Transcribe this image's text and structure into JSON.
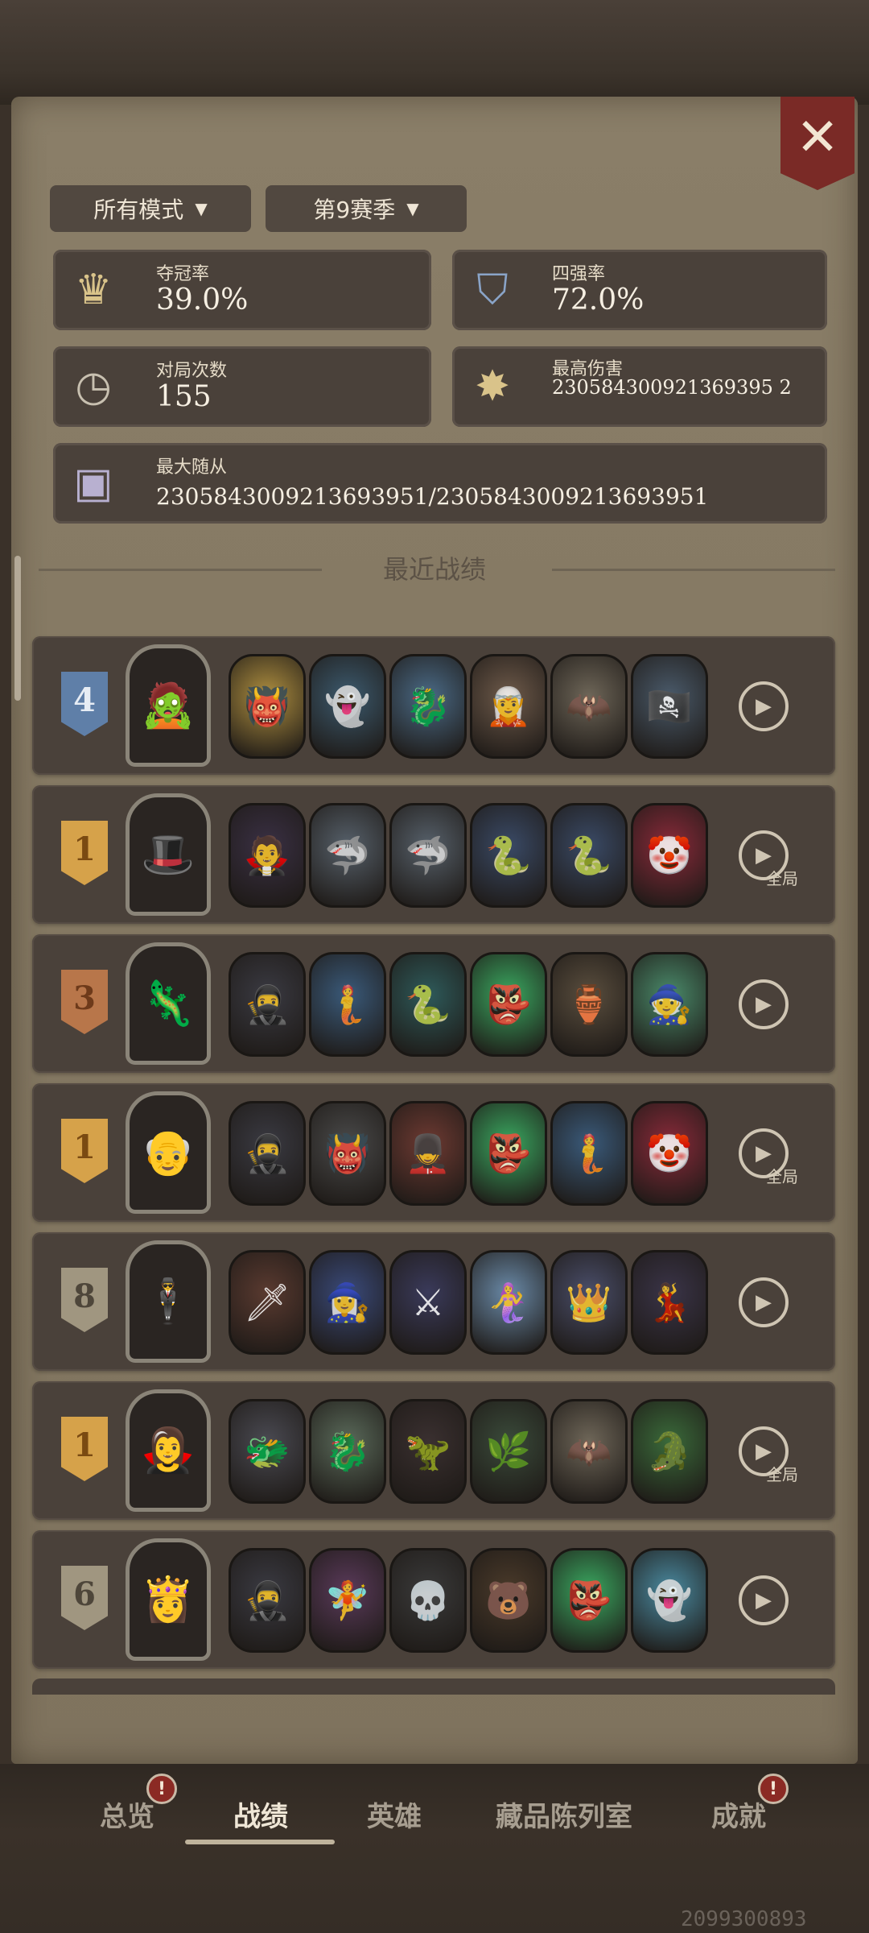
{
  "filters": {
    "mode_label": "所有模式",
    "season_label": "第9赛季",
    "dropdown_icon": "triangle-down-icon"
  },
  "stats": {
    "win_rate": {
      "label": "夺冠率",
      "value": "39.0%",
      "icon": "crown-icon"
    },
    "top4_rate": {
      "label": "四强率",
      "value": "72.0%",
      "icon": "shield-four-icon"
    },
    "games_played": {
      "label": "对局次数",
      "value": "155",
      "icon": "clock-icon"
    },
    "max_damage": {
      "label": "最高伤害",
      "value": "230584300921369395 2",
      "icon": "burst-icon"
    },
    "max_minion": {
      "label": "最大随从",
      "value": "2305843009213693951/2305843009213693951",
      "icon": "minion-portrait-icon"
    }
  },
  "section": {
    "title": "最近战绩"
  },
  "matches": [
    {
      "rank": "4",
      "badge_color": "#5f7fa8",
      "text_color": "#e6ecf4",
      "hero_icon": "🧟",
      "minions": [
        [
          "👹",
          "#b09040"
        ],
        [
          "👻",
          "#3c5a6e"
        ],
        [
          "🐉",
          "#4a6a86"
        ],
        [
          "🧝",
          "#6e5a4a"
        ],
        [
          "🦇",
          "#6e6658"
        ],
        [
          "🏴‍☠️",
          "#4a5a6a"
        ]
      ],
      "full_label": ""
    },
    {
      "rank": "1",
      "badge_color": "#d6a24a",
      "text_color": "#7a4a12",
      "hero_icon": "🎩",
      "minions": [
        [
          "🧛",
          "#3a3044"
        ],
        [
          "🦈",
          "#56606a"
        ],
        [
          "🦈",
          "#56606a"
        ],
        [
          "🐍",
          "#3a4a66"
        ],
        [
          "🐍",
          "#3a4a66"
        ],
        [
          "🤡",
          "#8a2a3a"
        ]
      ],
      "full_label": "全局"
    },
    {
      "rank": "3",
      "badge_color": "#b8764a",
      "text_color": "#6e3a1a",
      "hero_icon": "🦎",
      "minions": [
        [
          "🥷",
          "#3a3a42"
        ],
        [
          "🧜",
          "#3a5a7a"
        ],
        [
          "🐍",
          "#2e5a5a"
        ],
        [
          "👺",
          "#3aa860"
        ],
        [
          "🏺",
          "#5a4e3e"
        ],
        [
          "🧙",
          "#4a8a6a"
        ]
      ],
      "full_label": ""
    },
    {
      "rank": "1",
      "badge_color": "#d6a24a",
      "text_color": "#7a4a12",
      "hero_icon": "👴",
      "minions": [
        [
          "🥷",
          "#3a3a42"
        ],
        [
          "👹",
          "#4a4a4a"
        ],
        [
          "💂",
          "#6e3a32"
        ],
        [
          "👺",
          "#3aa860"
        ],
        [
          "🧜",
          "#3a5a7a"
        ],
        [
          "🤡",
          "#8a2a3a"
        ]
      ],
      "full_label": "全局"
    },
    {
      "rank": "8",
      "badge_color": "#a09680",
      "text_color": "#4e463a",
      "hero_icon": "🕴",
      "minions": [
        [
          "🗡",
          "#5a3a30"
        ],
        [
          "🧙‍♀️",
          "#3a4a7a"
        ],
        [
          "⚔",
          "#3a3a5a"
        ],
        [
          "🧜‍♀️",
          "#6a8aa8"
        ],
        [
          "👑",
          "#4a4e6a"
        ],
        [
          "💃",
          "#3a3448"
        ]
      ],
      "full_label": ""
    },
    {
      "rank": "1",
      "badge_color": "#d6a24a",
      "text_color": "#7a4a12",
      "hero_icon": "🧛‍♀️",
      "minions": [
        [
          "🐲",
          "#4a4a52"
        ],
        [
          "🐉",
          "#5a6a5a"
        ],
        [
          "🦖",
          "#3a3030"
        ],
        [
          "🌿",
          "#3a4a3a"
        ],
        [
          "🦇",
          "#6e6658"
        ],
        [
          "🐊",
          "#3a6a3a"
        ]
      ],
      "full_label": "全局"
    },
    {
      "rank": "6",
      "badge_color": "#a09680",
      "text_color": "#4e463a",
      "hero_icon": "👸",
      "minions": [
        [
          "🥷",
          "#3a3a42"
        ],
        [
          "🧚",
          "#5a3a5a"
        ],
        [
          "💀",
          "#3a3a3a"
        ],
        [
          "🐻",
          "#4a3a2a"
        ],
        [
          "👺",
          "#3aa860"
        ],
        [
          "👻",
          "#4a8aa0"
        ]
      ],
      "full_label": ""
    }
  ],
  "nav": {
    "overview": "总览",
    "records": "战绩",
    "heroes": "英雄",
    "collection": "藏品陈列室",
    "achievements": "成就",
    "alert_mark": "!"
  },
  "footer": {
    "player_id": "2099300893"
  },
  "close_label": "✕"
}
